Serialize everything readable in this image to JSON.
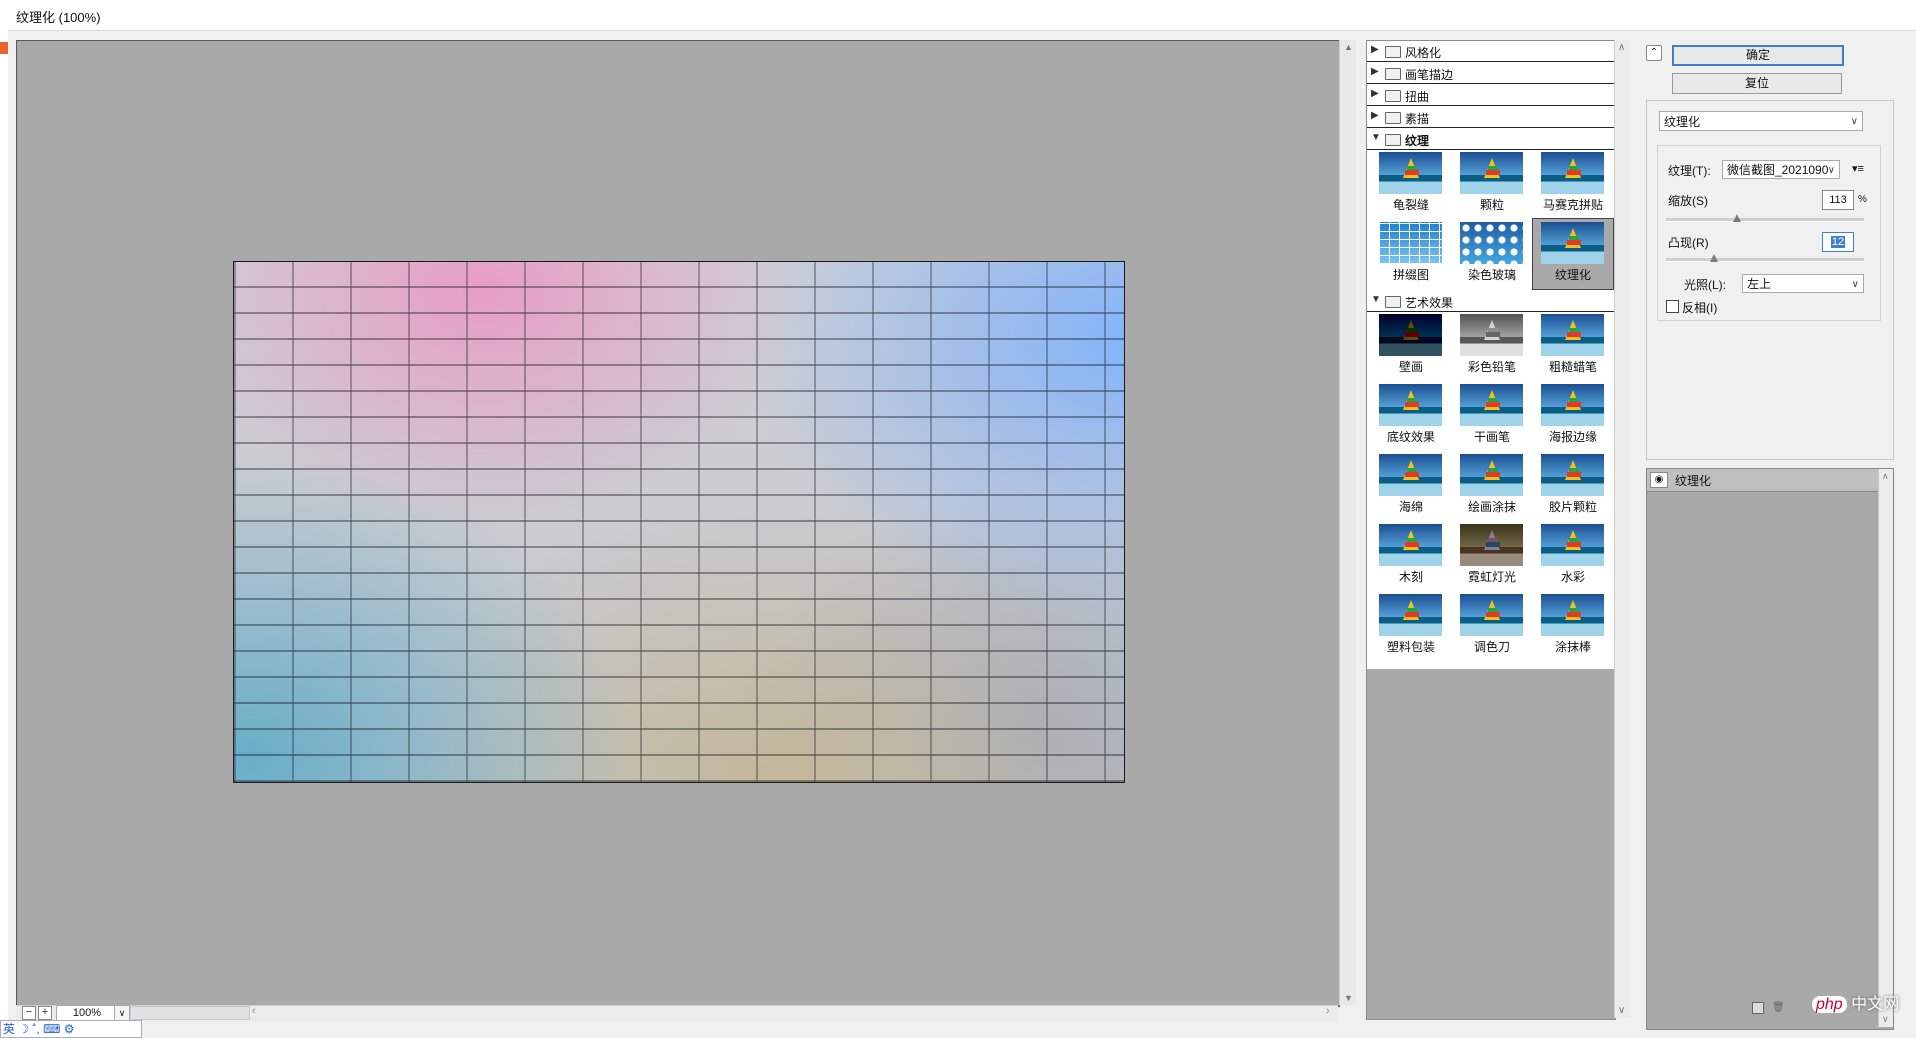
{
  "window": {
    "title": "纹理化 (100%)"
  },
  "preview": {
    "zoom": "100%",
    "zoom_minus": "−",
    "zoom_plus": "+",
    "zoom_dropdown": "∨"
  },
  "gallery": {
    "categories": [
      {
        "label": "风格化"
      },
      {
        "label": "画笔描边"
      },
      {
        "label": "扭曲"
      },
      {
        "label": "素描"
      }
    ],
    "texture_category": {
      "label": "纹理",
      "filters": [
        "龟裂缝",
        "颗粒",
        "马赛克拼贴",
        "拼缀图",
        "染色玻璃",
        "纹理化"
      ],
      "selected": "纹理化"
    },
    "art_category": {
      "label": "艺术效果",
      "filters": [
        "壁画",
        "彩色铅笔",
        "粗糙蜡笔",
        "底纹效果",
        "干画笔",
        "海报边缘",
        "海绵",
        "绘画涂抹",
        "胶片颗粒",
        "木刻",
        "霓虹灯光",
        "水彩",
        "塑料包装",
        "调色刀",
        "涂抹棒"
      ]
    }
  },
  "settings": {
    "ok_label": "确定",
    "reset_label": "复位",
    "filter_select": "纹理化",
    "texture_label": "纹理(T):",
    "texture_value": "微信截图_2021090",
    "scale_label": "缩放(S)",
    "scale_value": "113",
    "scale_unit": "%",
    "scale_fraction": 0.36,
    "relief_label": "凸现(R)",
    "relief_value": "12",
    "relief_fraction": 0.24,
    "light_label": "光照(L):",
    "light_value": "左上",
    "invert_label": "反相(I)",
    "invert_checked": false
  },
  "layers": {
    "items": [
      {
        "name": "纹理化",
        "visible": true
      }
    ]
  },
  "ime": {
    "text": "英 ☽ ˚, ⌨ ⚙"
  },
  "watermark": {
    "text": "php",
    "suffix": "中文网"
  },
  "colors": {
    "accent": "#3c7fce",
    "preview_bg": "#a9a9a9"
  }
}
